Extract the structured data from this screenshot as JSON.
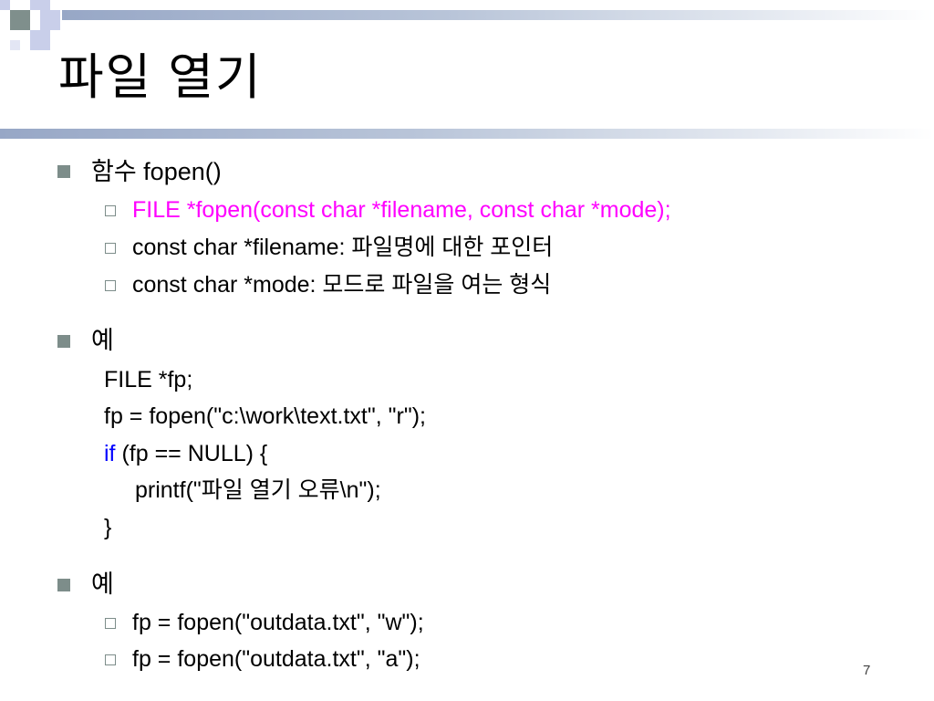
{
  "title": "파일 열기",
  "sections": [
    {
      "bullet": "함수 fopen()",
      "subitems": [
        "FILE *fopen(const char *filename, const char *mode);",
        "const char *filename: 파일명에 대한 포인터",
        "const char *mode:  모드로 파일을 여는 형식"
      ]
    },
    {
      "bullet": "예",
      "code": {
        "line1": "FILE *fp;",
        "line2": "fp = fopen(\"c:\\work\\text.txt\", \"r\");",
        "line3_kw": "if",
        "line3_rest": " (fp == NULL) {",
        "line4": "printf(\"파일 열기 오류\\n\");",
        "line5": "}"
      }
    },
    {
      "bullet": "예",
      "subitems": [
        "fp = fopen(\"outdata.txt\", \"w\");",
        "fp = fopen(\"outdata.txt\", \"a\");"
      ]
    }
  ],
  "page_number": "7",
  "colors": {
    "highlight": "#ff00ff",
    "keyword": "#0000ff",
    "bullet": "#7d8d8a"
  }
}
